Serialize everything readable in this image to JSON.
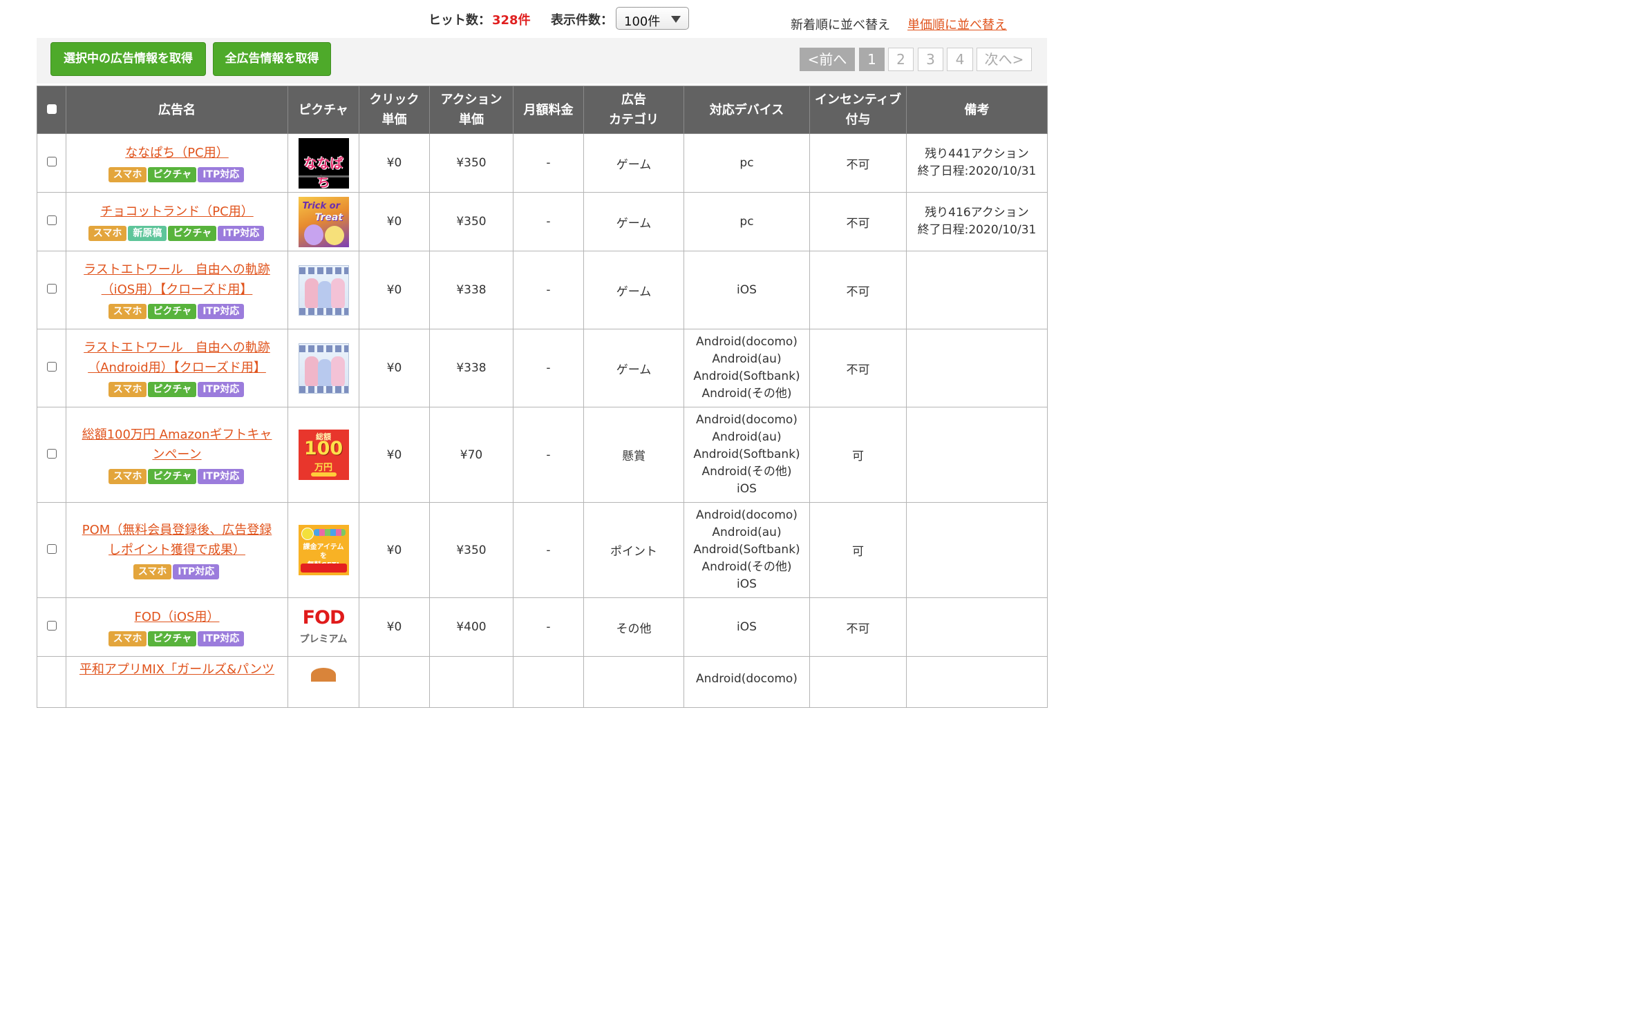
{
  "header": {
    "hits_label": "ヒット数：",
    "hits_count": "328件",
    "per_page_label": "表示件数：",
    "per_page_value": "100件",
    "sort_newest": "新着順に並べ替え",
    "sort_price": "単価順に並べ替え"
  },
  "toolbar": {
    "get_selected_label": "選択中の広告情報を取得",
    "get_all_label": "全広告情報を取得",
    "pagination": {
      "prev": "<前へ",
      "pages": [
        "1",
        "2",
        "3",
        "4"
      ],
      "current": "1",
      "next": "次へ>"
    }
  },
  "table": {
    "columns": {
      "name": "広告名",
      "picture": "ピクチャ",
      "click_price_1": "クリック",
      "click_price_2": "単価",
      "action_price_1": "アクション",
      "action_price_2": "単価",
      "monthly_fee": "月額料金",
      "category_1": "広告",
      "category_2": "カテゴリ",
      "devices": "対応デバイス",
      "incentive_1": "インセンティブ",
      "incentive_2": "付与",
      "notes": "備考"
    },
    "rows": [
      {
        "title": "ななぱち（PC用）",
        "tags": [
          "スマホ",
          "ピクチャ",
          "ITP対応"
        ],
        "thumb_text": "ななぱち",
        "click_price": "¥0",
        "action_price": "¥350",
        "monthly_fee": "-",
        "category": "ゲーム",
        "devices": [
          "pc"
        ],
        "incentive": "不可",
        "notes": [
          "残り441アクション",
          "終了日程:2020/10/31"
        ]
      },
      {
        "title": "チョコットランド（PC用）",
        "tags": [
          "スマホ",
          "新原稿",
          "ピクチャ",
          "ITP対応"
        ],
        "thumb_text_a": "Trick or",
        "thumb_text_b": "Treat",
        "click_price": "¥0",
        "action_price": "¥350",
        "monthly_fee": "-",
        "category": "ゲーム",
        "devices": [
          "pc"
        ],
        "incentive": "不可",
        "notes": [
          "残り416アクション",
          "終了日程:2020/10/31"
        ]
      },
      {
        "title_1": "ラストエトワール　自由への軌跡",
        "title_2": "（iOS用）【クローズド用】",
        "tags": [
          "スマホ",
          "ピクチャ",
          "ITP対応"
        ],
        "click_price": "¥0",
        "action_price": "¥338",
        "monthly_fee": "-",
        "category": "ゲーム",
        "devices": [
          "iOS"
        ],
        "incentive": "不可",
        "notes": []
      },
      {
        "title_1": "ラストエトワール　自由への軌跡",
        "title_2": "（Android用）【クローズド用】",
        "tags": [
          "スマホ",
          "ピクチャ",
          "ITP対応"
        ],
        "click_price": "¥0",
        "action_price": "¥338",
        "monthly_fee": "-",
        "category": "ゲーム",
        "devices": [
          "Android(docomo)",
          "Android(au)",
          "Android(Softbank)",
          "Android(その他)"
        ],
        "incentive": "不可",
        "notes": []
      },
      {
        "title_1": "総額100万円 Amazonギフトキャ",
        "title_2": "ンペーン",
        "tags": [
          "スマホ",
          "ピクチャ",
          "ITP対応"
        ],
        "thumb_text_a": "総額",
        "thumb_text_b": "100",
        "thumb_text_c": "万円",
        "click_price": "¥0",
        "action_price": "¥70",
        "monthly_fee": "-",
        "category": "懸賞",
        "devices": [
          "Android(docomo)",
          "Android(au)",
          "Android(Softbank)",
          "Android(その他)",
          "iOS"
        ],
        "incentive": "可",
        "notes": []
      },
      {
        "title_1": "POM（無料会員登録後、広告登録",
        "title_2": "しポイント獲得で成果）",
        "tags": [
          "スマホ",
          "ITP対応"
        ],
        "thumb_text_a": "課金アイテムを",
        "thumb_text_b": "無料GET!",
        "click_price": "¥0",
        "action_price": "¥350",
        "monthly_fee": "-",
        "category": "ポイント",
        "devices": [
          "Android(docomo)",
          "Android(au)",
          "Android(Softbank)",
          "Android(その他)",
          "iOS"
        ],
        "incentive": "可",
        "notes": []
      },
      {
        "title": "FOD（iOS用）",
        "tags": [
          "スマホ",
          "ピクチャ",
          "ITP対応"
        ],
        "thumb_text_a": "FOD",
        "thumb_text_b": "プレミアム",
        "click_price": "¥0",
        "action_price": "¥400",
        "monthly_fee": "-",
        "category": "その他",
        "devices": [
          "iOS"
        ],
        "incentive": "不可",
        "notes": []
      },
      {
        "title_1": "平和アプリMIX「ガールズ&パンツ",
        "devices": [
          "Android(docomo)"
        ]
      }
    ]
  }
}
